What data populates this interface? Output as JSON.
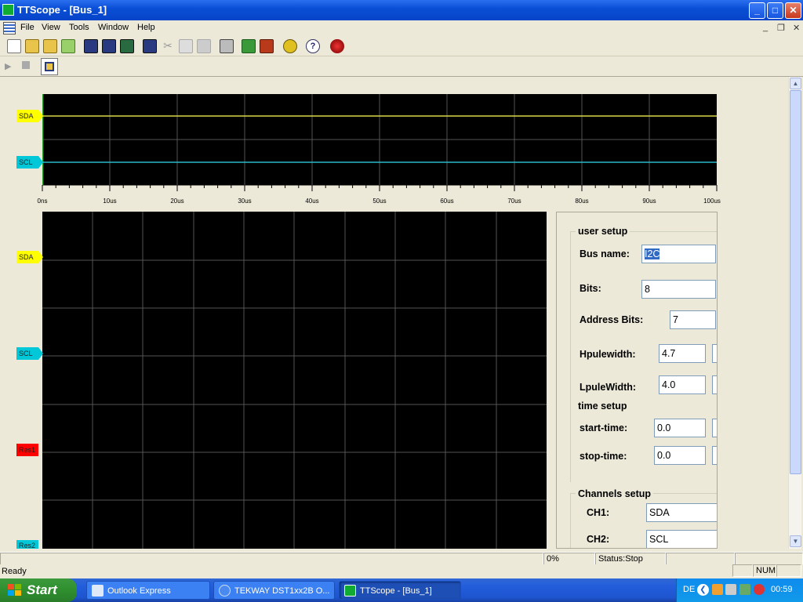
{
  "window": {
    "title": "TTScope - [Bus_1]",
    "min_label": "_",
    "max_label": "□",
    "close_label": "✕"
  },
  "menu": [
    "File",
    "View",
    "Tools",
    "Window",
    "Help"
  ],
  "mdi_controls": [
    "_",
    "❐",
    "✕"
  ],
  "overview": {
    "channels": [
      "SDA",
      "SCL"
    ],
    "time_ticks": [
      "0ns",
      "10us",
      "20us",
      "30us",
      "40us",
      "50us",
      "60us",
      "70us",
      "80us",
      "90us",
      "100us"
    ]
  },
  "main": {
    "channels": [
      "SDA",
      "SCL",
      "Res1",
      "Res2"
    ]
  },
  "panel": {
    "user_setup": {
      "title": "user setup",
      "bus_name_label": "Bus name:",
      "bus_name": "I2C",
      "bits_label": "Bits:",
      "bits": "8",
      "address_bits_label": "Address Bits:",
      "address_bits": "7",
      "hpulse_label": "Hpulewidth:",
      "hpulse": "4.7",
      "lpulse_label": "LpuleWidth:",
      "lpulse": "4.0"
    },
    "time_setup": {
      "title": "time setup",
      "start_label": "start-time:",
      "start": "0.0",
      "stop_label": "stop-time:",
      "stop": "0.0"
    },
    "channels_setup": {
      "title": "Channels setup",
      "ch1_label": "CH1:",
      "ch1": "SDA",
      "ch2_label": "CH2:",
      "ch2": "SCL"
    }
  },
  "status": {
    "progress": "0%",
    "state": "Status:Stop",
    "ready": "Ready",
    "num": "NUM"
  },
  "taskbar": {
    "start": "Start",
    "tasks": [
      "Outlook Express",
      "TEKWAY DST1xx2B O...",
      "TTScope - [Bus_1]"
    ],
    "lang": "DE",
    "clock": "00:59"
  },
  "colors": {
    "sda": "#ffff00",
    "scl": "#00c8d8",
    "res1": "#ff0000",
    "res2": "#00c8d8",
    "trace_sda": "#d8d84a",
    "trace_scl": "#2ab7c8"
  }
}
